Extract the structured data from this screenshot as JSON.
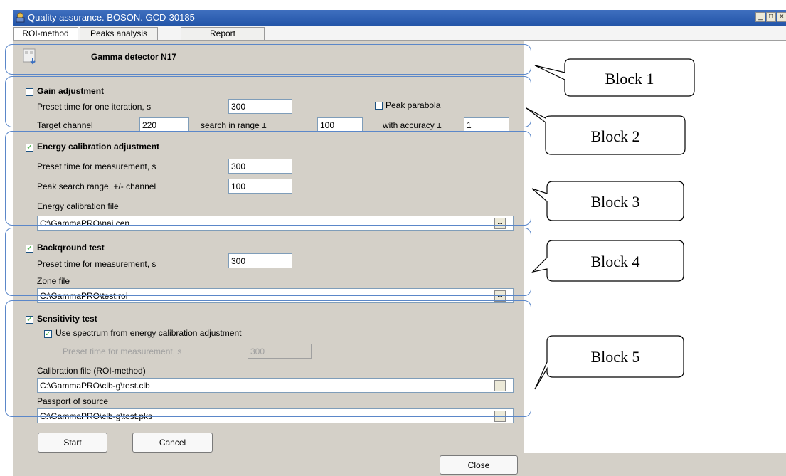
{
  "window": {
    "title": "Quality assurance. BOSON. GCD-30185",
    "controls": {
      "minimize": "_",
      "maximize": "□",
      "close": "×"
    }
  },
  "tabs": [
    {
      "label": "ROI-method"
    },
    {
      "label": "Peaks analysis"
    },
    {
      "label": "Report"
    }
  ],
  "detector": {
    "label": "Gamma detector N17",
    "icon": "download-doc-icon"
  },
  "gain": {
    "header": "Gain adjustment",
    "checked": false,
    "preset_label": "Preset time for one iteration, s",
    "preset_value": "300",
    "peak_parabola_label": "Peak parabola",
    "peak_parabola_checked": false,
    "target_label": "Target channel",
    "target_value": "220",
    "search_label": "search in range ±",
    "search_value": "100",
    "accuracy_label": "with accuracy ±",
    "accuracy_value": "1"
  },
  "energy": {
    "header": "Energy calibration adjustment",
    "checked": true,
    "check_mark": "✓",
    "preset_label": "Preset time for measurement, s",
    "preset_value": "300",
    "range_label": "Peak search range, +/- channel",
    "range_value": "100",
    "file_label": "Energy calibration file",
    "file_value": "C:\\GammaPRO\\nai.cen"
  },
  "background": {
    "header": "Backqround test",
    "checked": true,
    "check_mark": "✓",
    "preset_label": "Preset time for measurement, s",
    "preset_value": "300",
    "zone_label": "Zone file",
    "zone_value": "C:\\GammaPRO\\test.roi"
  },
  "sensitivity": {
    "header": "Sensitivity test",
    "checked": true,
    "check_mark": "✓",
    "use_spectrum_label": "Use spectrum from energy calibration adjustment",
    "use_spectrum_checked": true,
    "preset_label": "Preset time for measurement, s",
    "preset_value": "300",
    "calib_label": "Calibration file (ROI-method)",
    "calib_value": "C:\\GammaPRO\\clb-g\\test.clb",
    "passport_label": "Passport of source",
    "passport_value": "C:\\GammaPRO\\clb-g\\test.pks"
  },
  "browse_label": "...",
  "buttons": {
    "start": "Start",
    "cancel": "Cancel",
    "close": "Close"
  },
  "callouts": [
    "Block 1",
    "Block 2",
    "Block 3",
    "Block 4",
    "Block 5"
  ],
  "colors": {
    "titlebar": "#2355a8",
    "panel": "#d4d0c8",
    "outline": "#5b87c9",
    "check": "#21a121"
  }
}
